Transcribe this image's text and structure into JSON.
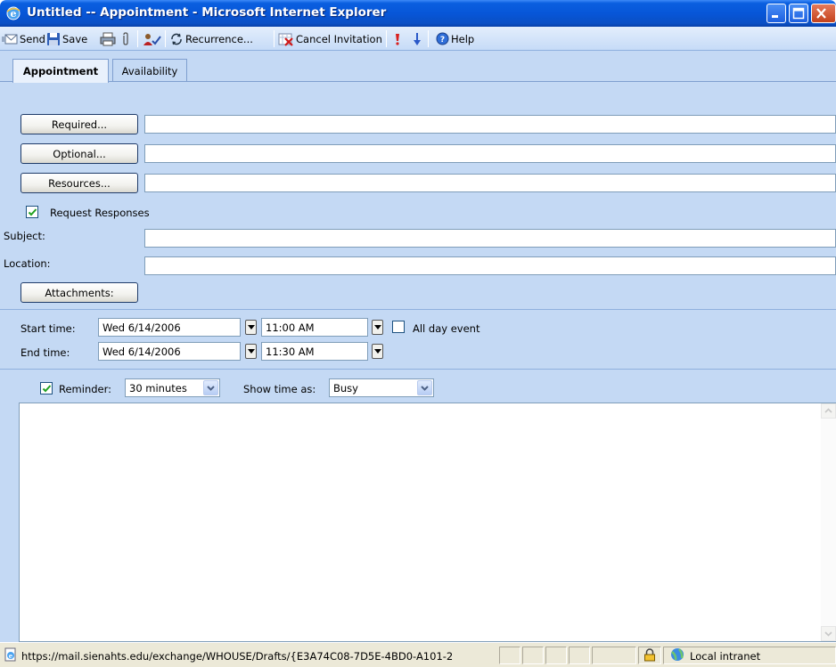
{
  "window": {
    "title": "Untitled -- Appointment - Microsoft Internet Explorer"
  },
  "toolbar": {
    "send_label": "Send",
    "save_label": "Save",
    "recurrence_label": "Recurrence...",
    "cancel_invitation_label": "Cancel Invitation",
    "help_label": "Help"
  },
  "tabs": [
    {
      "label": "Appointment",
      "active": true
    },
    {
      "label": "Availability",
      "active": false
    }
  ],
  "attendees": {
    "required_label": "Required...",
    "required_value": "",
    "optional_label": "Optional...",
    "optional_value": "",
    "resources_label": "Resources...",
    "resources_value": ""
  },
  "request_responses": {
    "label": "Request Responses",
    "checked": true
  },
  "subject": {
    "label": "Subject:",
    "value": ""
  },
  "location": {
    "label": "Location:",
    "value": ""
  },
  "attachments_label": "Attachments:",
  "schedule": {
    "start_label": "Start time:",
    "start_date": "Wed 6/14/2006",
    "start_time": "11:00 AM",
    "all_day_label": "All day event",
    "all_day_checked": false,
    "end_label": "End time:",
    "end_date": "Wed 6/14/2006",
    "end_time": "11:30 AM"
  },
  "reminder": {
    "checked": true,
    "label": "Reminder:",
    "value": "30 minutes",
    "show_time_label": "Show time as:",
    "show_time_value": "Busy"
  },
  "statusbar": {
    "url": "https://mail.sienahts.edu/exchange/WHOUSE/Drafts/{E3A74C08-7D5E-4BD0-A101-2",
    "zone": "Local intranet"
  },
  "colors": {
    "form_bg": "#c4d9f4",
    "titlebar": "#0756d8",
    "accent": "#1c5180"
  }
}
